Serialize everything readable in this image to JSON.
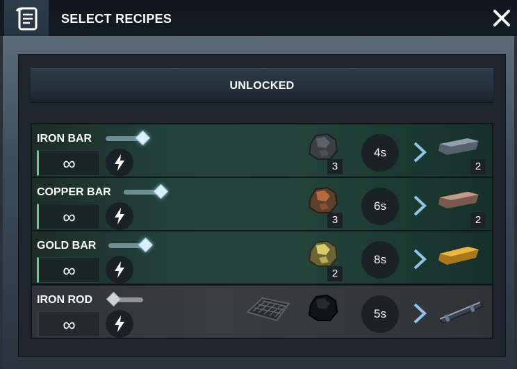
{
  "header": {
    "title": "SELECT RECIPES",
    "close_label": "✕"
  },
  "section": {
    "label": "UNLOCKED"
  },
  "recipes": [
    {
      "name": "IRON BAR",
      "repeat": "∞",
      "slider_level": 1.0,
      "ingredients": [
        {
          "icon": "iron-ore-icon",
          "qty": "3"
        }
      ],
      "time": "4s",
      "product": {
        "icon": "iron-bar-icon",
        "qty": "2"
      },
      "state": "active"
    },
    {
      "name": "COPPER BAR",
      "repeat": "∞",
      "slider_level": 1.0,
      "ingredients": [
        {
          "icon": "copper-ore-icon",
          "qty": "3"
        }
      ],
      "time": "6s",
      "product": {
        "icon": "copper-bar-icon",
        "qty": "2"
      },
      "state": "active"
    },
    {
      "name": "GOLD BAR",
      "repeat": "∞",
      "slider_level": 1.0,
      "ingredients": [
        {
          "icon": "gold-ore-icon",
          "qty": "2"
        }
      ],
      "time": "8s",
      "product": {
        "icon": "gold-bar-icon",
        "qty": ""
      },
      "state": "active"
    },
    {
      "name": "IRON ROD",
      "repeat": "∞",
      "slider_level": 0.0,
      "ingredients": [
        {
          "icon": "metal-grate-icon",
          "qty": ""
        },
        {
          "icon": "coal-icon",
          "qty": ""
        }
      ],
      "time": "5s",
      "product": {
        "icon": "iron-rod-icon",
        "qty": ""
      },
      "state": "inactive"
    }
  ],
  "colors": {
    "active_row": "#25453c",
    "inactive_row": "#3a3d40",
    "accent_green": "#66d08b",
    "slider_knob": "#dbeefa"
  }
}
